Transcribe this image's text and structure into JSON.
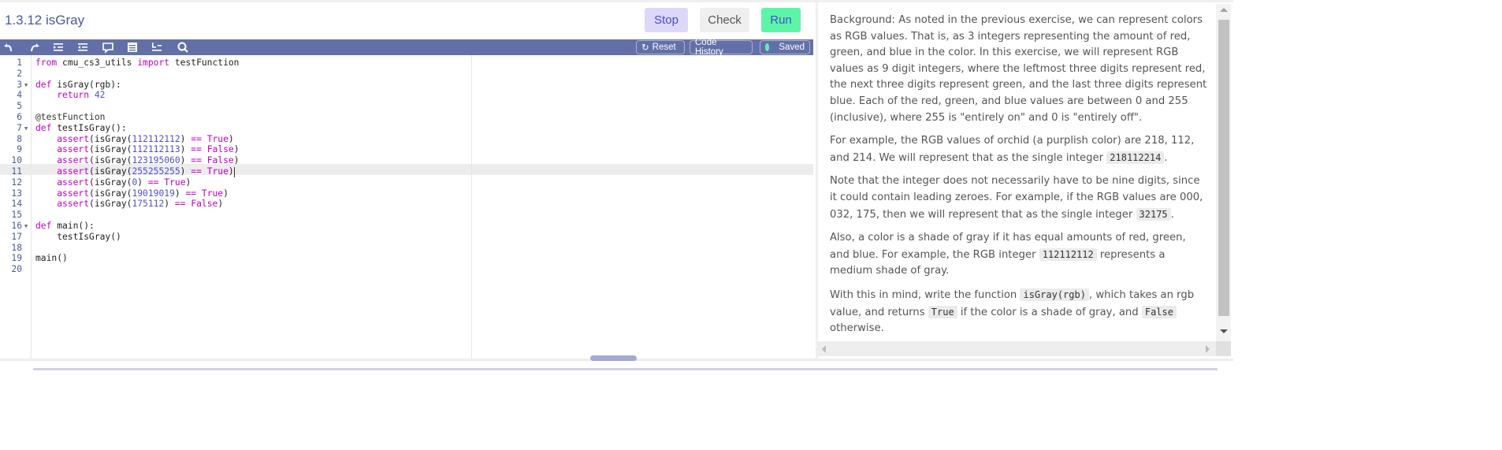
{
  "header": {
    "title": "1.3.12 isGray",
    "stop_label": "Stop",
    "check_label": "Check",
    "run_label": "Run"
  },
  "toolbar": {
    "icons": [
      "undo-icon",
      "redo-icon",
      "indent-icon",
      "outdent-icon",
      "comment-icon",
      "format-icon",
      "toggle-whitespace-icon",
      "search-icon"
    ],
    "reset_label": "Reset",
    "history_label": "Code History",
    "saved_label": "Saved",
    "saved_color": "#5cf5a8"
  },
  "editor": {
    "active_line": 11,
    "lines": [
      {
        "n": "1",
        "text": "from cmu_cs3_utils import testFunction"
      },
      {
        "n": "2",
        "text": ""
      },
      {
        "n": "3",
        "text": "def isGray(rgb):",
        "fold": true
      },
      {
        "n": "4",
        "text": "    return 42"
      },
      {
        "n": "5",
        "text": ""
      },
      {
        "n": "6",
        "text": "@testFunction"
      },
      {
        "n": "7",
        "text": "def testIsGray():",
        "fold": true
      },
      {
        "n": "8",
        "text": "    assert(isGray(112112112) == True)"
      },
      {
        "n": "9",
        "text": "    assert(isGray(112112113) == False)"
      },
      {
        "n": "10",
        "text": "    assert(isGray(123195060) == False)"
      },
      {
        "n": "11",
        "text": "    assert(isGray(255255255) == True)"
      },
      {
        "n": "12",
        "text": "    assert(isGray(0) == True)"
      },
      {
        "n": "13",
        "text": "    assert(isGray(19019019) == True)"
      },
      {
        "n": "14",
        "text": "    assert(isGray(175112) == False)"
      },
      {
        "n": "15",
        "text": ""
      },
      {
        "n": "16",
        "text": "def main():",
        "fold": true
      },
      {
        "n": "17",
        "text": "    testIsGray()"
      },
      {
        "n": "18",
        "text": ""
      },
      {
        "n": "19",
        "text": "main()"
      },
      {
        "n": "20",
        "text": ""
      }
    ]
  },
  "description": {
    "p1": "Background: As noted in the previous exercise, we can represent colors as RGB values. That is, as 3 integers representing the amount of red, green, and blue in the color. In this exercise, we will represent RGB values as 9 digit integers, where the leftmost three digits represent red, the next three digits represent green, and the last three digits represent blue. Each of the red, green, and blue values are between 0 and 255 (inclusive), where 255 is \"entirely on\" and 0 is \"entirely off\".",
    "p2_a": "For example, the RGB values of orchid (a purplish color) are 218, 112, and 214. We will represent that as the single integer ",
    "p2_code": "218112214",
    "p2_b": ".",
    "p3_a": "Note that the integer does not necessarily have to be nine digits, since it could contain leading zeroes. For example, if the RGB values are 000, 032, 175, then we will represent that as the single integer ",
    "p3_code": "32175",
    "p3_b": ".",
    "p4_a": "Also, a color is a shade of gray if it has equal amounts of red, green, and blue. For example, the RGB integer ",
    "p4_code": "112112112",
    "p4_b": " represents a medium shade of gray.",
    "p5_a": "With this in mind, write the function ",
    "p5_code1": "isGray(rgb)",
    "p5_b": ", which takes an rgb value, and returns ",
    "p5_code2": "True",
    "p5_c": " if the color is a shade of gray, and ",
    "p5_code3": "False",
    "p5_d": " otherwise."
  },
  "colors": {
    "accent": "#6370a8",
    "title": "#4a5a9a",
    "keyword": "#c000c0",
    "number": "#5050d0"
  }
}
